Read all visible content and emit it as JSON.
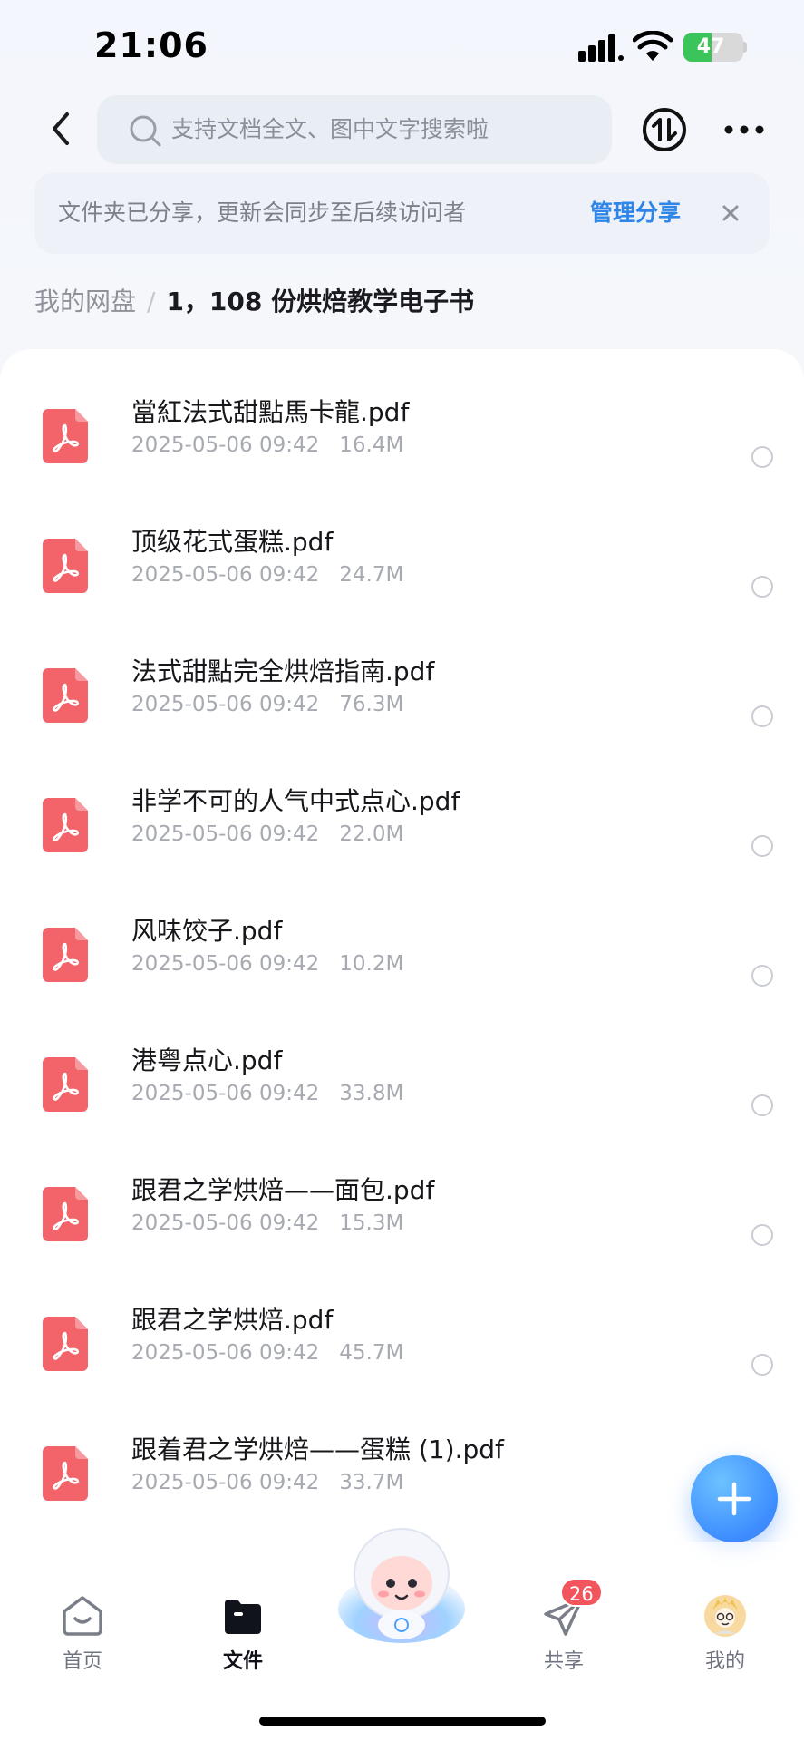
{
  "status_bar": {
    "time": "21:06",
    "battery_percent": 47,
    "battery_label": "47"
  },
  "header": {
    "search_placeholder": "支持文档全文、图中文字搜索啦"
  },
  "share_banner": {
    "text": "文件夹已分享，更新会同步至后续访问者",
    "action_label": "管理分享"
  },
  "breadcrumb": {
    "root": "我的网盘",
    "separator": "/",
    "current": "1，108 份烘焙教学电子书"
  },
  "files": [
    {
      "name": "當紅法式甜點馬卡龍.pdf",
      "date": "2025-05-06 09:42",
      "size": "16.4M"
    },
    {
      "name": "顶级花式蛋糕.pdf",
      "date": "2025-05-06 09:42",
      "size": "24.7M"
    },
    {
      "name": "法式甜點完全烘焙指南.pdf",
      "date": "2025-05-06 09:42",
      "size": "76.3M"
    },
    {
      "name": "非学不可的人气中式点心.pdf",
      "date": "2025-05-06 09:42",
      "size": "22.0M"
    },
    {
      "name": "风味饺子.pdf",
      "date": "2025-05-06 09:42",
      "size": "10.2M"
    },
    {
      "name": "港粤点心.pdf",
      "date": "2025-05-06 09:42",
      "size": "33.8M"
    },
    {
      "name": "跟君之学烘焙——面包.pdf",
      "date": "2025-05-06 09:42",
      "size": "15.3M"
    },
    {
      "name": "跟君之学烘焙.pdf",
      "date": "2025-05-06 09:42",
      "size": "45.7M"
    },
    {
      "name": "跟着君之学烘焙——蛋糕 (1).pdf",
      "date": "2025-05-06 09:42",
      "size": "33.7M"
    }
  ],
  "bottom_nav": {
    "home": "首页",
    "files": "文件",
    "share": "共享",
    "share_badge": "26",
    "mine": "我的"
  },
  "colors": {
    "accent": "#2f86e8",
    "pdf_red": "#f2636a",
    "fab_blue": "#3d8dff",
    "badge_red": "#f2555c"
  }
}
